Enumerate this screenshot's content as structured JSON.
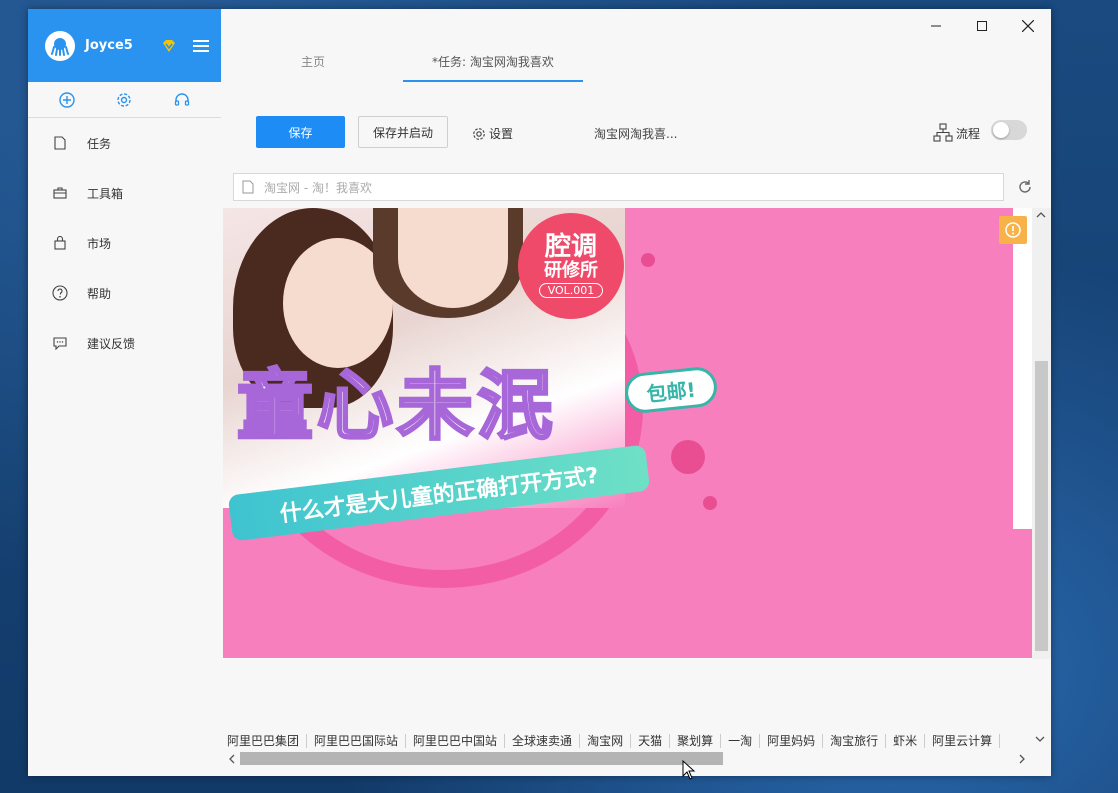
{
  "user": {
    "name": "Joyce5"
  },
  "sidebar": {
    "quick_actions": [
      {
        "icon": "plus-circle-icon"
      },
      {
        "icon": "gear-icon"
      },
      {
        "icon": "headset-icon"
      }
    ],
    "items": [
      {
        "label": "任务",
        "icon": "document-icon"
      },
      {
        "label": "工具箱",
        "icon": "toolbox-icon"
      },
      {
        "label": "市场",
        "icon": "bag-icon"
      },
      {
        "label": "帮助",
        "icon": "help-icon"
      },
      {
        "label": "建议反馈",
        "icon": "chat-icon"
      }
    ]
  },
  "tabs": [
    {
      "label": "主页",
      "active": false
    },
    {
      "label": "*任务: 淘宝网淘我喜欢",
      "active": true
    }
  ],
  "toolbar": {
    "save_label": "保存",
    "save_start_label": "保存并启动",
    "settings_label": "设置",
    "task_name": "淘宝网淘我喜...",
    "flow_label": "流程",
    "flow_enabled": false
  },
  "url_bar": {
    "value": "淘宝网 - 淘！我喜欢"
  },
  "banner": {
    "stamp_line1": "腔调",
    "stamp_line2": "研修所",
    "stamp_vol": "VOL.001",
    "title": "童心未泯",
    "subtitle": "什么才是大儿童的正确打开方式?",
    "bubble": "包邮!",
    "colors": {
      "background": "#f77fbd",
      "ribbon": "#3ec3d0",
      "stamp": "#ef4a6a"
    }
  },
  "footer_links": [
    "阿里巴巴集团",
    "阿里巴巴国际站",
    "阿里巴巴中国站",
    "全球速卖通",
    "淘宝网",
    "天猫",
    "聚划算",
    "一淘",
    "阿里妈妈",
    "淘宝旅行",
    "虾米",
    "阿里云计算"
  ],
  "colors": {
    "accent": "#2a93f0",
    "primary_button": "#1e8cf5",
    "warning": "#f8b24a"
  }
}
